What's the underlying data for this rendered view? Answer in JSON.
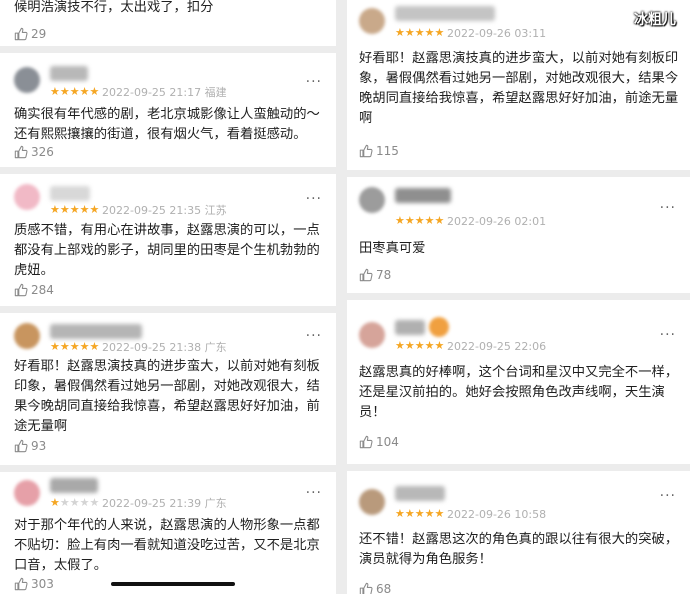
{
  "watermark": "冰粗儿",
  "colors": {
    "star": "#f5a623",
    "star_empty": "#d4d4d4",
    "meta": "#b0b0b0",
    "text": "#1f1f1f",
    "separator": "#ececec"
  },
  "icons": {
    "like": "thumbs-up-icon",
    "more": "more-dots-icon",
    "user": "avatar-icon"
  },
  "left_reviews": [
    {
      "stars": 5,
      "meta": "",
      "text": "候明浩演技不行，太出戏了，扣分",
      "likes": "29"
    },
    {
      "stars": 5,
      "meta": "2022-09-25 21:17 福建",
      "text": "确实很有年代感的剧，老北京城影像让人蛮触动的～还有熙熙攘攘的街道，很有烟火气，看着挺感动。",
      "likes": "326"
    },
    {
      "stars": 5,
      "meta": "2022-09-25 21:35 江苏",
      "text": "质感不错，有用心在讲故事，赵露思演的可以，一点都没有上部戏的影子，胡同里的田枣是个生机勃勃的虎妞。",
      "likes": "284"
    },
    {
      "stars": 5,
      "meta": "2022-09-25 21:38 广东",
      "text": "好看耶！赵露思演技真的进步蛮大，以前对她有刻板印象，暑假偶然看过她另一部剧，对她改观很大，结果今晚胡同直接给我惊喜，希望赵露思好好加油，前途无量啊",
      "likes": "93"
    },
    {
      "stars": 1,
      "meta": "2022-09-25 21:39 广东",
      "text": "对于那个年代的人来说，赵露思演的人物形象一点都不贴切：脸上有肉一看就知道没吃过苦，又不是北京口音，太假了。",
      "likes": "303"
    }
  ],
  "right_reviews": [
    {
      "stars": 5,
      "meta": "2022-09-26 03:11",
      "text": "好看耶！赵露思演技真的进步蛮大，以前对她有刻板印象，暑假偶然看过她另一部剧，对她改观很大，结果今晚胡同直接给我惊喜，希望赵露思好好加油，前途无量啊",
      "likes": "115"
    },
    {
      "stars": 5,
      "meta": "2022-09-26 02:01",
      "text": "田枣真可爱",
      "likes": "78"
    },
    {
      "stars": 5,
      "meta": "2022-09-25 22:06",
      "text": "赵露思真的好棒啊，这个台词和星汉中又完全不一样，还是星汉前拍的。她好会按照角色改声线啊，天生演员！",
      "likes": "104"
    },
    {
      "stars": 5,
      "meta": "2022-09-26 10:58",
      "text": "还不错！赵露思这次的角色真的跟以往有很大的突破，演员就得为角色服务！",
      "likes": "68"
    }
  ]
}
